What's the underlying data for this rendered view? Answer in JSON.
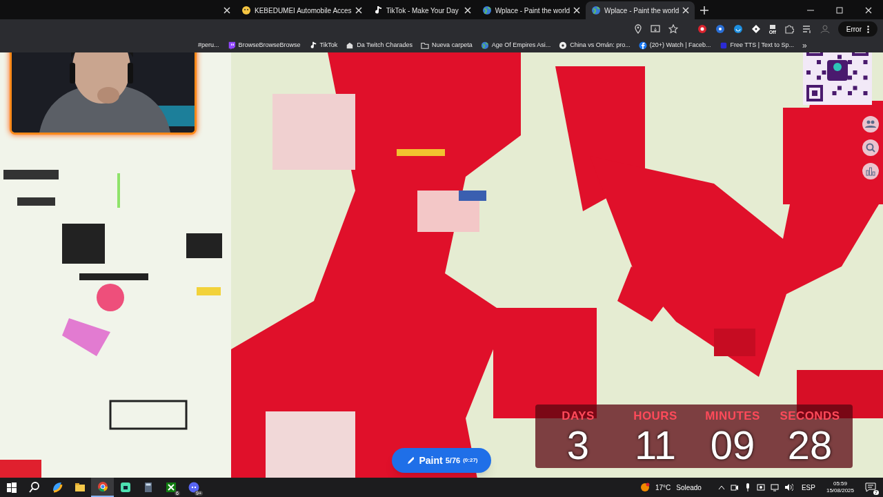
{
  "tabs": [
    {
      "title": "KEBEDUMEI Automobile Acces",
      "selected": false,
      "kind": "smile"
    },
    {
      "title": "TikTok - Make Your Day",
      "selected": false,
      "kind": "note"
    },
    {
      "title": "Wplace - Paint the world",
      "selected": false,
      "kind": "globe"
    },
    {
      "title": "Wplace - Paint the world",
      "selected": true,
      "kind": "globe"
    }
  ],
  "toolbar": {
    "extension_badge": "Off",
    "error_button": "Error"
  },
  "bookmarks": [
    {
      "label": "#peru..."
    },
    {
      "label": "BrowseBrowseBrowse",
      "kind": "twitch"
    },
    {
      "label": "TikTok",
      "kind": "note"
    },
    {
      "label": "Da Twitch Charades",
      "kind": "puzzle"
    },
    {
      "label": "Nueva carpeta",
      "kind": "folder"
    },
    {
      "label": "Age Of Empires Asi...",
      "kind": "globe"
    },
    {
      "label": "China vs Omán: pro...",
      "kind": "ball"
    },
    {
      "label": "(20+) Watch | Faceb...",
      "kind": "facebook"
    },
    {
      "label": "Free TTS | Text to Sp...",
      "kind": "plain"
    }
  ],
  "bookmarks_more": "»",
  "countdown": [
    {
      "label": "DAYS",
      "value": "3"
    },
    {
      "label": "HOURS",
      "value": "11"
    },
    {
      "label": "MINUTES",
      "value": "09"
    },
    {
      "label": "SECONDS",
      "value": "28"
    }
  ],
  "paint_button": {
    "label": "Paint",
    "count": "5/76",
    "timer": "(0:27)"
  },
  "taskbar": {
    "apps": [
      {
        "kind": "start",
        "selected": false
      },
      {
        "kind": "search",
        "selected": false
      },
      {
        "kind": "copilot",
        "selected": false
      },
      {
        "kind": "folder",
        "selected": false
      },
      {
        "kind": "chrome",
        "selected": true
      },
      {
        "kind": "app",
        "selected": false
      },
      {
        "kind": "calculator",
        "selected": false
      },
      {
        "kind": "xbox",
        "badge": "6",
        "selected": false
      },
      {
        "kind": "discord",
        "badge": "9+",
        "selected": false
      }
    ],
    "weather_temp": "17°C",
    "weather_text": "Soleado",
    "language": "ESP",
    "time": "05:59",
    "date": "15/08/2025",
    "notifications": "7"
  }
}
